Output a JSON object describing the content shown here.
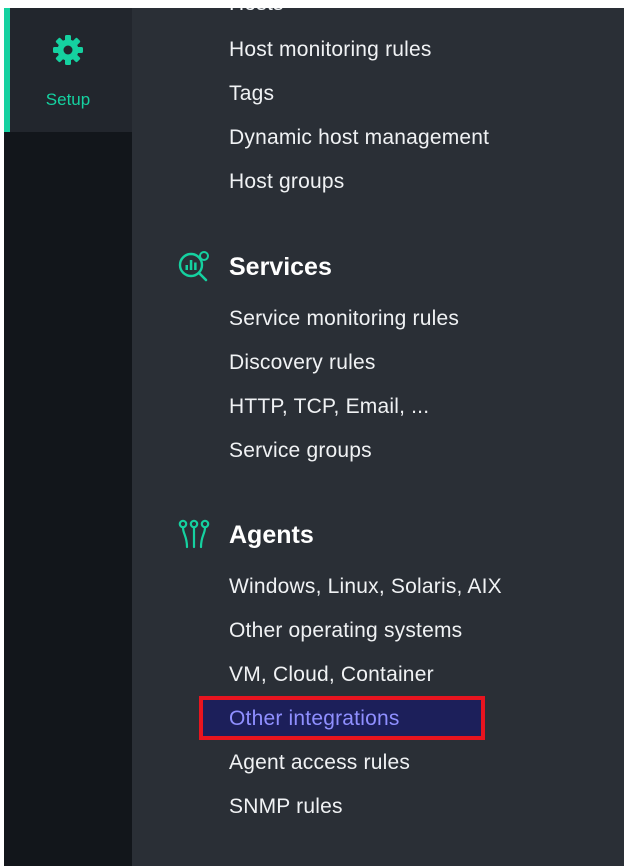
{
  "nav": {
    "setup_label": "Setup",
    "setup_icon": "gear-icon",
    "accent_color": "#15d1a0"
  },
  "menu": {
    "hosts_partial": "Hosts",
    "hosts_items": [
      "Host monitoring rules",
      "Tags",
      "Dynamic host management",
      "Host groups"
    ],
    "services": {
      "title": "Services",
      "icon": "services-icon",
      "items": [
        "Service monitoring rules",
        "Discovery rules",
        "HTTP, TCP, Email, ...",
        "Service groups"
      ]
    },
    "agents": {
      "title": "Agents",
      "icon": "agents-icon",
      "items": [
        "Windows, Linux, Solaris, AIX",
        "Other operating systems",
        "VM, Cloud, Container",
        "Other integrations",
        "Agent access rules",
        "SNMP rules"
      ],
      "highlighted_item": "Other integrations",
      "highlight_border_color": "#e8141f"
    }
  }
}
